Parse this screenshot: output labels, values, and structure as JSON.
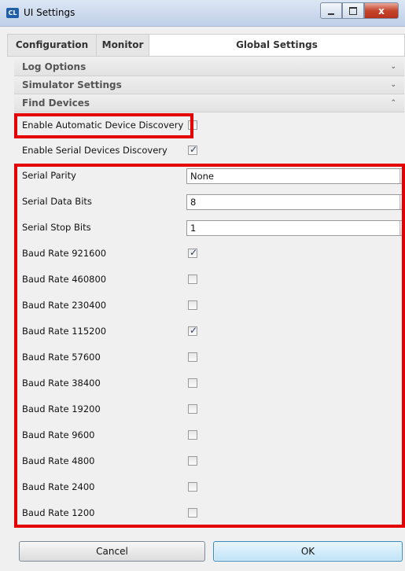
{
  "window": {
    "title": "UI Settings",
    "app_icon_text": "CL",
    "close_glyph": "x"
  },
  "tabs": [
    {
      "label": "Configuration"
    },
    {
      "label": "Monitor"
    },
    {
      "label": "Global Settings"
    }
  ],
  "sections": [
    {
      "label": "Log Options",
      "state": "collapsed",
      "chevron": "⌄"
    },
    {
      "label": "Simulator Settings",
      "state": "collapsed",
      "chevron": "⌄"
    },
    {
      "label": "Find Devices",
      "state": "expanded",
      "chevron": "⌃"
    }
  ],
  "find_devices": {
    "auto_discovery": {
      "label": "Enable Automatic Device Discovery",
      "checked": false
    },
    "serial_discovery": {
      "label": "Enable Serial Devices Discovery",
      "checked": true
    },
    "serial_parity": {
      "label": "Serial Parity",
      "value": "None"
    },
    "serial_data_bits": {
      "label": "Serial Data Bits",
      "value": "8"
    },
    "serial_stop_bits": {
      "label": "Serial Stop Bits",
      "value": "1"
    },
    "baud_rates": [
      {
        "label": "Baud Rate 921600",
        "checked": true
      },
      {
        "label": "Baud Rate 460800",
        "checked": false
      },
      {
        "label": "Baud Rate 230400",
        "checked": false
      },
      {
        "label": "Baud Rate 115200",
        "checked": true
      },
      {
        "label": "Baud Rate 57600",
        "checked": false
      },
      {
        "label": "Baud Rate 38400",
        "checked": false
      },
      {
        "label": "Baud Rate 19200",
        "checked": false
      },
      {
        "label": "Baud Rate 9600",
        "checked": false
      },
      {
        "label": "Baud Rate 4800",
        "checked": false
      },
      {
        "label": "Baud Rate 2400",
        "checked": false
      },
      {
        "label": "Baud Rate 1200",
        "checked": false
      }
    ]
  },
  "buttons": {
    "cancel": "Cancel",
    "ok": "OK"
  },
  "colors": {
    "highlight": "#e50000",
    "ok_button": "#bfe3f7"
  }
}
